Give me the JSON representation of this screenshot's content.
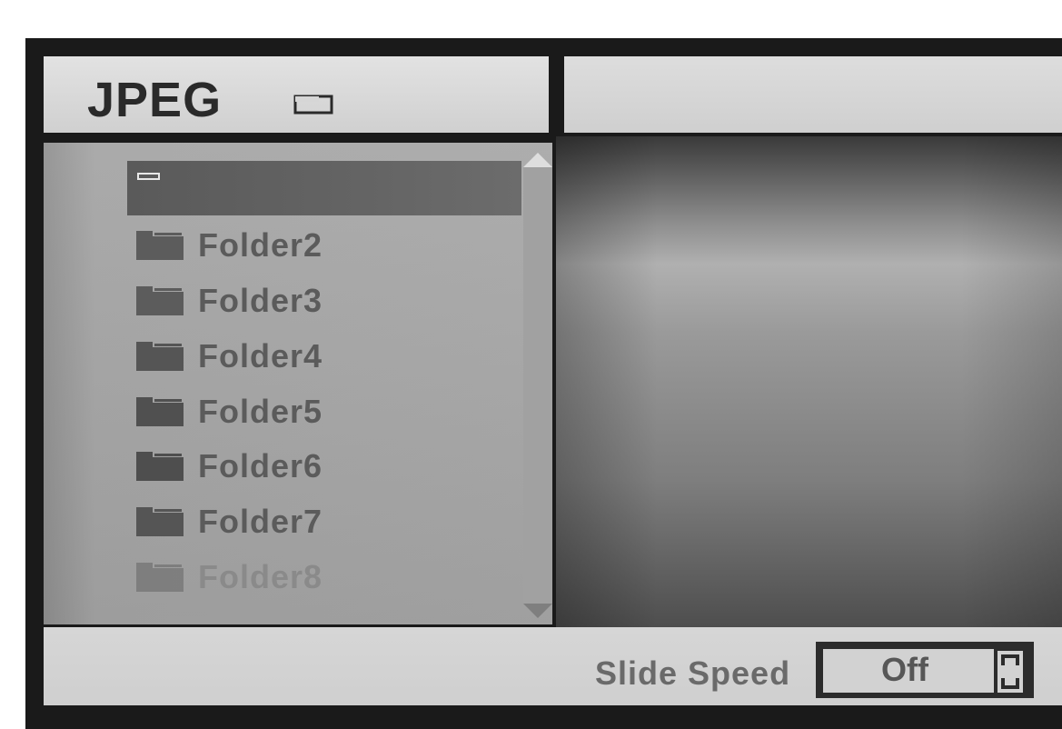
{
  "header": {
    "title": "JPEG",
    "disc_icon": "disc-tray-icon"
  },
  "file_list": {
    "selected": {
      "icon": "parent-folder-icon"
    },
    "folders": [
      {
        "label": "Folder2",
        "icon": "folder-icon"
      },
      {
        "label": "Folder3",
        "icon": "folder-icon"
      },
      {
        "label": "Folder4",
        "icon": "folder-icon"
      },
      {
        "label": "Folder5",
        "icon": "folder-icon"
      },
      {
        "label": "Folder6",
        "icon": "folder-icon"
      },
      {
        "label": "Folder7",
        "icon": "folder-icon"
      },
      {
        "label": "Folder8",
        "icon": "folder-icon"
      }
    ],
    "scroll_up_icon": "scroll-up-arrow-icon",
    "scroll_down_icon": "scroll-down-arrow-icon"
  },
  "footer": {
    "slide_speed_label": "Slide Speed",
    "slide_speed_value": "Off",
    "stepper_icon": "up-down-stepper-icon"
  }
}
